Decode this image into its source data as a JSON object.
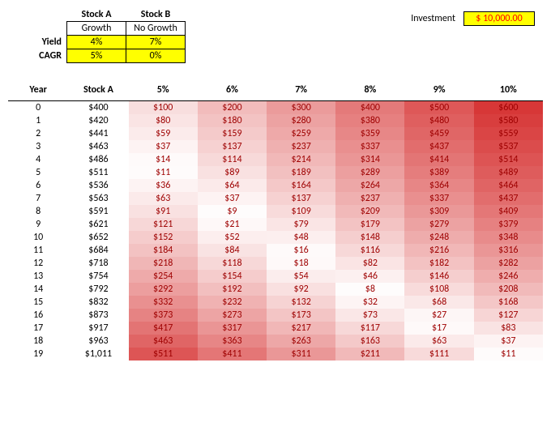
{
  "summary": {
    "stockA_name": "Stock A",
    "stockB_name": "Stock B",
    "stockA_growth": "Growth",
    "stockB_growth": "No Growth",
    "yield_label": "Yield",
    "cagr_label": "CAGR",
    "stockA_yield": "4%",
    "stockB_yield": "7%",
    "stockA_cagr": "5%",
    "stockB_cagr": "0%"
  },
  "investment": {
    "label": "Investment",
    "value": "$ 10,000.00"
  },
  "columns": {
    "year": "Year",
    "stockA": "Stock A",
    "c5": "5%",
    "c6": "6%",
    "c7": "7%",
    "c8": "8%",
    "c9": "9%",
    "c10": "10%"
  },
  "rows": [
    {
      "year": "0",
      "stockA": "$400",
      "c5": "$100",
      "c6": "$200",
      "c7": "$300",
      "c8": "$400",
      "c9": "$500",
      "c10": "$600"
    },
    {
      "year": "1",
      "stockA": "$420",
      "c5": "$80",
      "c6": "$180",
      "c7": "$280",
      "c8": "$380",
      "c9": "$480",
      "c10": "$580"
    },
    {
      "year": "2",
      "stockA": "$441",
      "c5": "$59",
      "c6": "$159",
      "c7": "$259",
      "c8": "$359",
      "c9": "$459",
      "c10": "$559"
    },
    {
      "year": "3",
      "stockA": "$463",
      "c5": "$37",
      "c6": "$137",
      "c7": "$237",
      "c8": "$337",
      "c9": "$437",
      "c10": "$537"
    },
    {
      "year": "4",
      "stockA": "$486",
      "c5": "$14",
      "c6": "$114",
      "c7": "$214",
      "c8": "$314",
      "c9": "$414",
      "c10": "$514"
    },
    {
      "year": "5",
      "stockA": "$511",
      "c5": "$11",
      "c6": "$89",
      "c7": "$189",
      "c8": "$289",
      "c9": "$389",
      "c10": "$489"
    },
    {
      "year": "6",
      "stockA": "$536",
      "c5": "$36",
      "c6": "$64",
      "c7": "$164",
      "c8": "$264",
      "c9": "$364",
      "c10": "$464"
    },
    {
      "year": "7",
      "stockA": "$563",
      "c5": "$63",
      "c6": "$37",
      "c7": "$137",
      "c8": "$237",
      "c9": "$337",
      "c10": "$437"
    },
    {
      "year": "8",
      "stockA": "$591",
      "c5": "$91",
      "c6": "$9",
      "c7": "$109",
      "c8": "$209",
      "c9": "$309",
      "c10": "$409"
    },
    {
      "year": "9",
      "stockA": "$621",
      "c5": "$121",
      "c6": "$21",
      "c7": "$79",
      "c8": "$179",
      "c9": "$279",
      "c10": "$379"
    },
    {
      "year": "10",
      "stockA": "$652",
      "c5": "$152",
      "c6": "$52",
      "c7": "$48",
      "c8": "$148",
      "c9": "$248",
      "c10": "$348"
    },
    {
      "year": "11",
      "stockA": "$684",
      "c5": "$184",
      "c6": "$84",
      "c7": "$16",
      "c8": "$116",
      "c9": "$216",
      "c10": "$316"
    },
    {
      "year": "12",
      "stockA": "$718",
      "c5": "$218",
      "c6": "$118",
      "c7": "$18",
      "c8": "$82",
      "c9": "$182",
      "c10": "$282"
    },
    {
      "year": "13",
      "stockA": "$754",
      "c5": "$254",
      "c6": "$154",
      "c7": "$54",
      "c8": "$46",
      "c9": "$146",
      "c10": "$246"
    },
    {
      "year": "14",
      "stockA": "$792",
      "c5": "$292",
      "c6": "$192",
      "c7": "$92",
      "c8": "$8",
      "c9": "$108",
      "c10": "$208"
    },
    {
      "year": "15",
      "stockA": "$832",
      "c5": "$332",
      "c6": "$232",
      "c7": "$132",
      "c8": "$32",
      "c9": "$68",
      "c10": "$168"
    },
    {
      "year": "16",
      "stockA": "$873",
      "c5": "$373",
      "c6": "$273",
      "c7": "$173",
      "c8": "$73",
      "c9": "$27",
      "c10": "$127"
    },
    {
      "year": "17",
      "stockA": "$917",
      "c5": "$417",
      "c6": "$317",
      "c7": "$217",
      "c8": "$117",
      "c9": "$17",
      "c10": "$83"
    },
    {
      "year": "18",
      "stockA": "$963",
      "c5": "$463",
      "c6": "$363",
      "c7": "$263",
      "c8": "$163",
      "c9": "$63",
      "c10": "$37"
    },
    {
      "year": "19",
      "stockA": "$1,011",
      "c5": "$511",
      "c6": "$411",
      "c7": "$311",
      "c8": "$211",
      "c9": "$111",
      "c10": "$11"
    }
  ],
  "diff_max": 600
}
